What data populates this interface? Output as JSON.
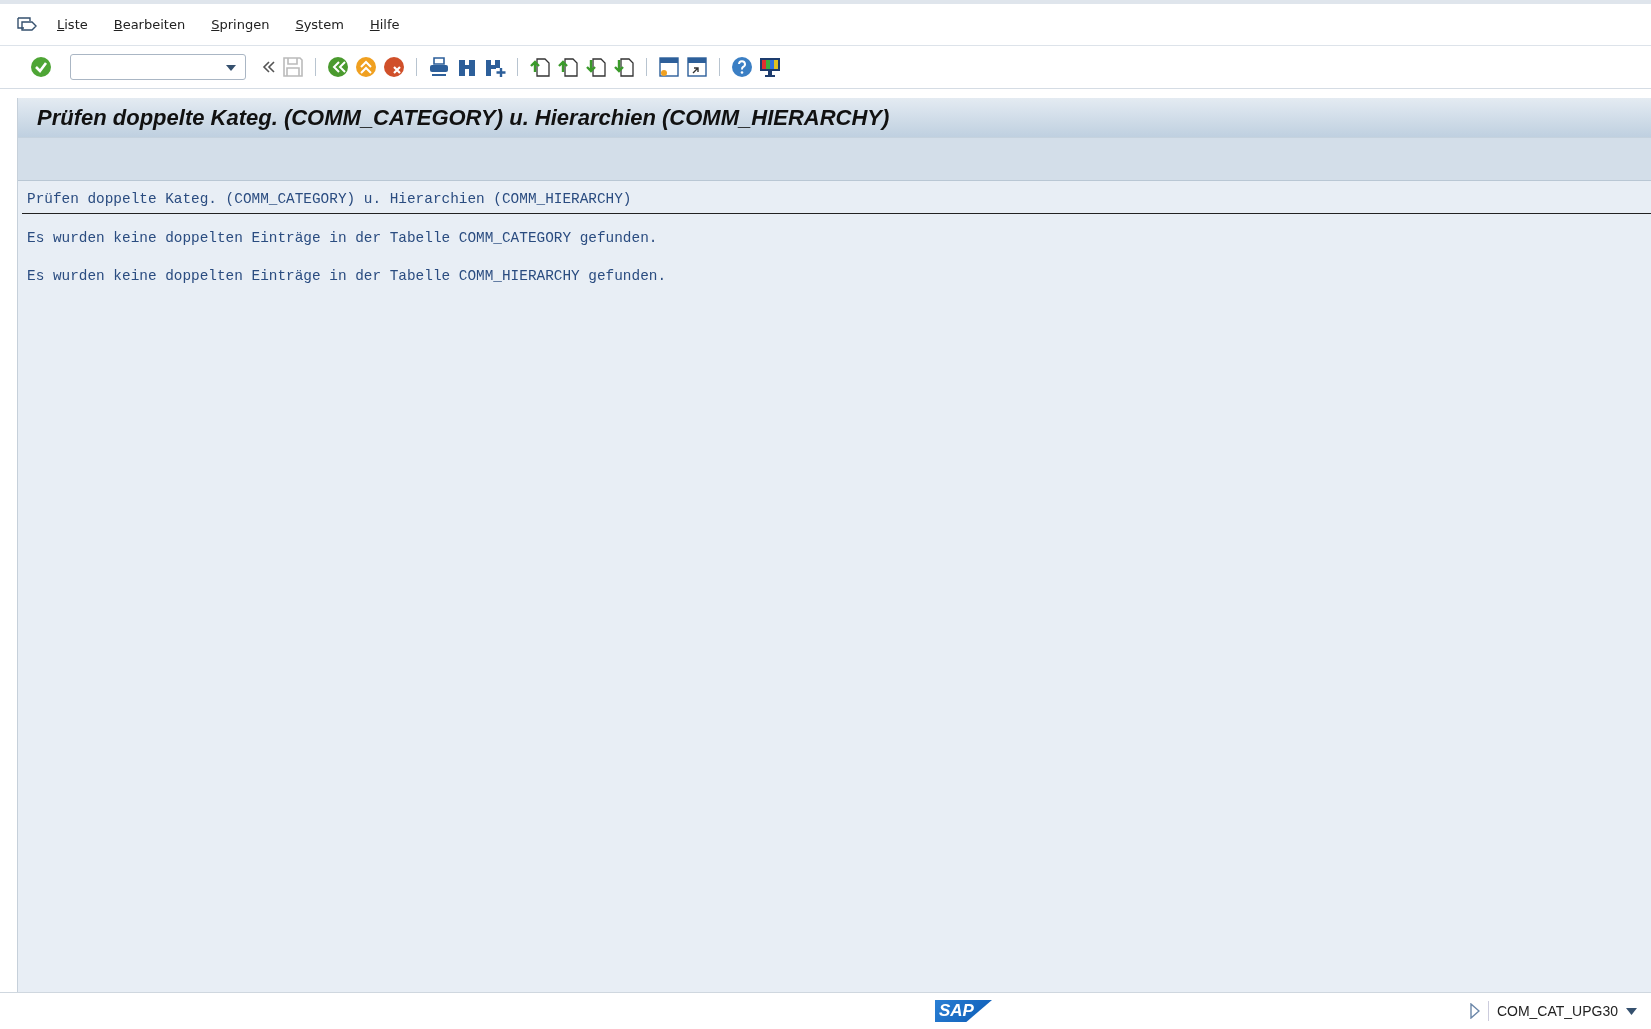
{
  "menu": [
    "Liste",
    "Bearbeiten",
    "Springen",
    "System",
    "Hilfe"
  ],
  "title": "Prüfen doppelte Kateg. (COMM_CATEGORY) u. Hierarchien (COMM_HIERARCHY)",
  "list": {
    "header": "Prüfen doppelte Kateg. (COMM_CATEGORY) u. Hierarchien (COMM_HIERARCHY)",
    "lines": [
      "Es wurden keine doppelten Einträge in der Tabelle COMM_CATEGORY gefunden.",
      "Es wurden keine doppelten Einträge in der Tabelle COMM_HIERARCHY gefunden."
    ]
  },
  "status_bar": {
    "logo": "SAP",
    "transaction": "COM_CAT_UPG30"
  }
}
